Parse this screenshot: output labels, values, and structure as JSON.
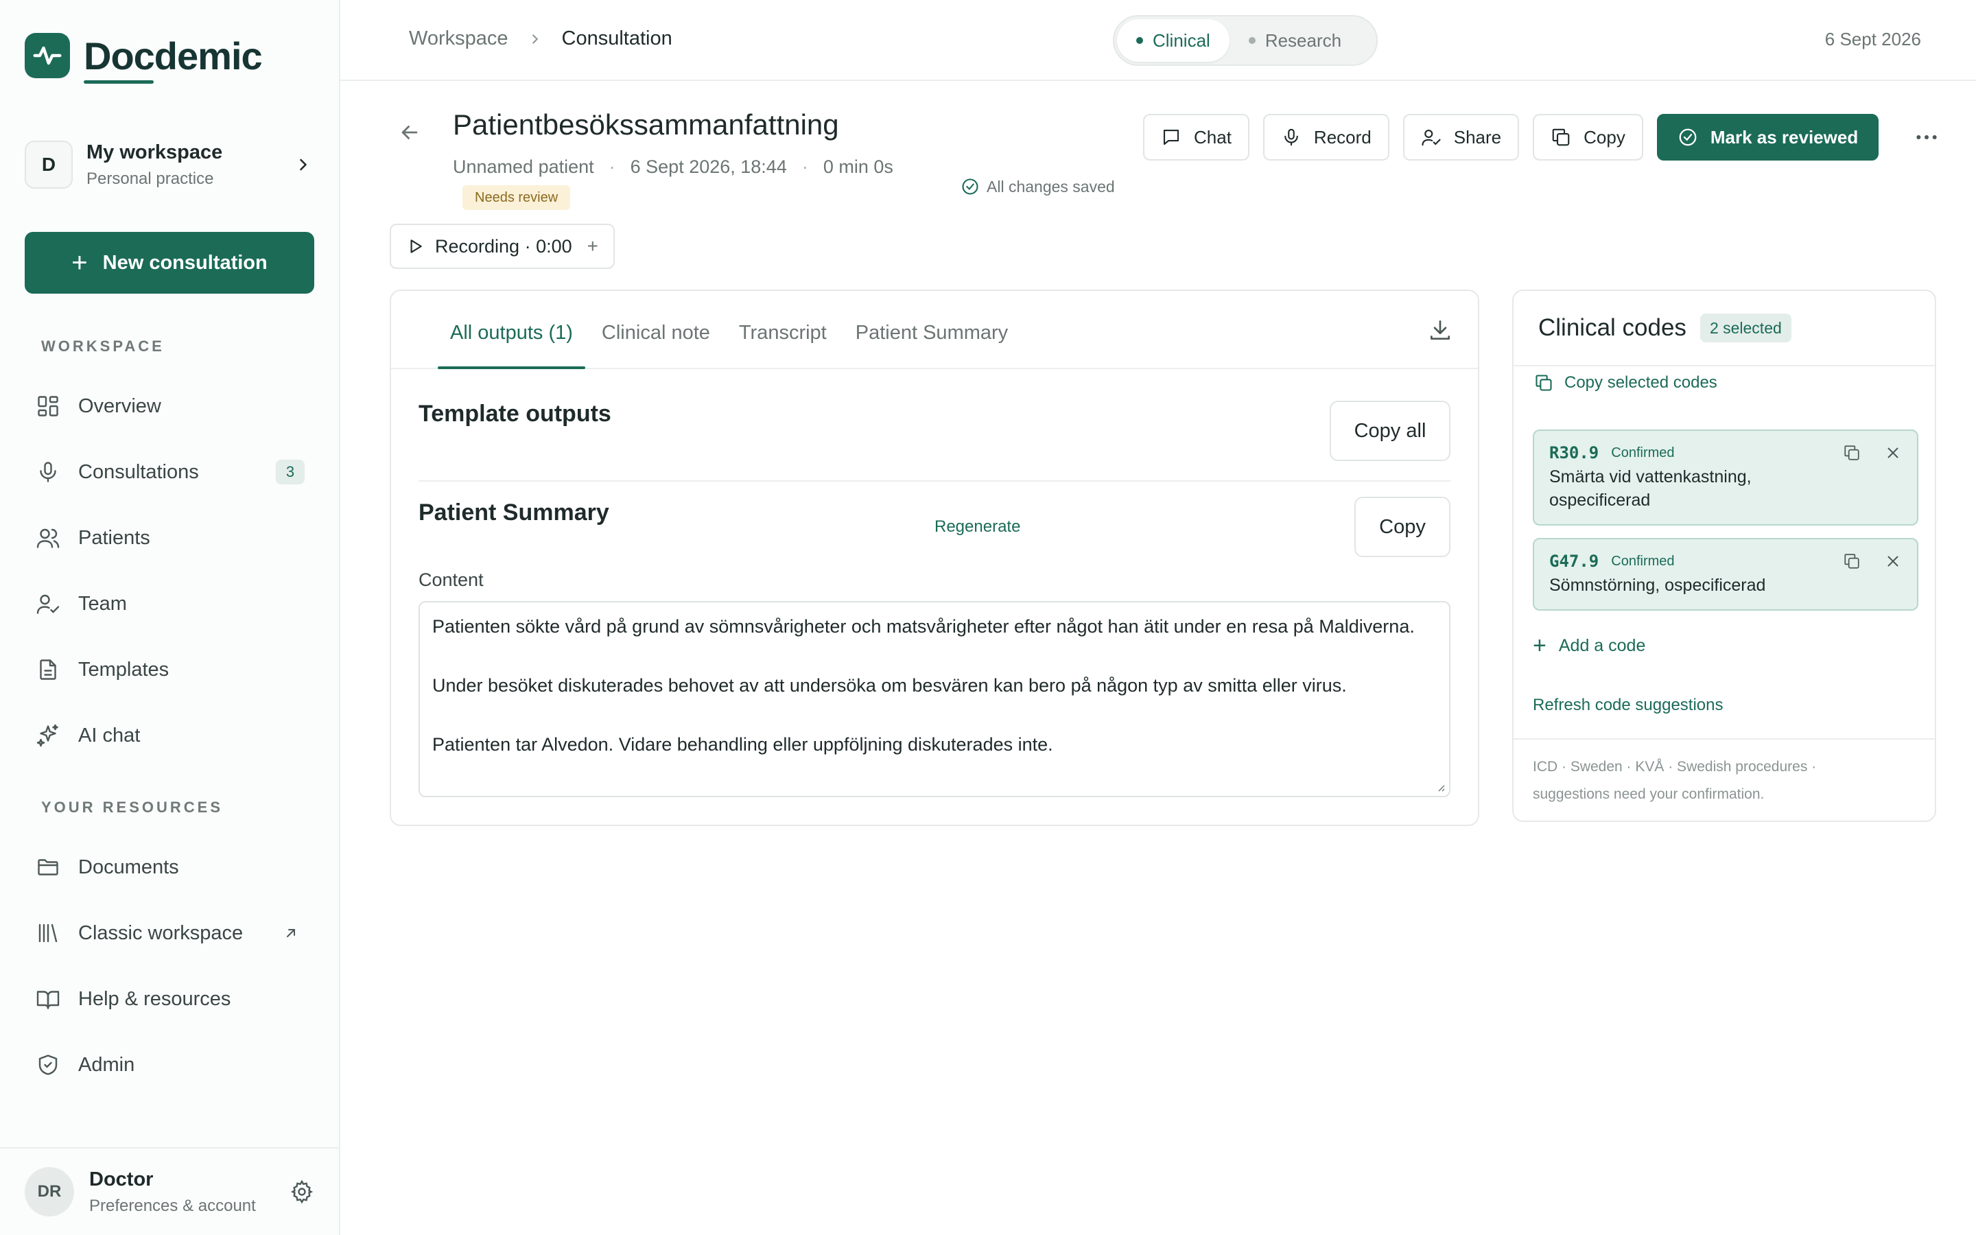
{
  "app": {
    "brand": "Docdemic",
    "workspace_title": "My workspace",
    "workspace_sub": "Personal practice",
    "workspace_initial": "D",
    "new_consultation": "New consultation"
  },
  "sidebar": {
    "workspace_label": "WORKSPACE",
    "resources_label": "YOUR RESOURCES",
    "items": [
      {
        "label": "Overview",
        "icon": "grid-icon"
      },
      {
        "label": "Consultations",
        "icon": "microphone-icon",
        "badge": "3"
      },
      {
        "label": "Patients",
        "icon": "users-icon"
      },
      {
        "label": "Team",
        "icon": "user-check-icon"
      },
      {
        "label": "Templates",
        "icon": "document-icon"
      },
      {
        "label": "AI chat",
        "icon": "sparkles-icon"
      }
    ],
    "resources": [
      {
        "label": "Documents",
        "icon": "folder-icon"
      },
      {
        "label": "Classic workspace",
        "icon": "library-icon"
      },
      {
        "label": "Help & resources",
        "icon": "book-icon"
      },
      {
        "label": "Admin",
        "icon": "shield-icon"
      }
    ],
    "user": {
      "initials": "DR",
      "name": "Doctor",
      "sub": "Preferences & account"
    }
  },
  "topbar": {
    "breadcrumb": [
      "Workspace",
      "Consultation"
    ],
    "modes": [
      "Clinical",
      "Research"
    ],
    "active_mode": "Clinical",
    "date": "6 Sept 2026"
  },
  "consultation": {
    "title": "Patientbesökssammanfattning",
    "patient": "Unnamed patient",
    "datetime": "6 Sept 2026, 18:44",
    "duration": "0 min 0s",
    "status": "Needs review",
    "saved": "All changes saved",
    "recording": "Recording · 0:00",
    "recording_add": "+"
  },
  "actions": {
    "chat": "Chat",
    "record": "Record",
    "share": "Share",
    "copy": "Copy",
    "mark_reviewed": "Mark as reviewed"
  },
  "outputs": {
    "tabs": [
      "All outputs (1)",
      "Clinical note",
      "Transcript",
      "Patient Summary"
    ],
    "active_tab": 0,
    "template_heading": "Template outputs",
    "copy_all": "Copy all",
    "summary_heading": "Patient Summary",
    "regenerate": "Regenerate",
    "copy": "Copy",
    "content_label": "Content",
    "content_paragraphs": [
      "Patienten sökte vård på grund av sömnsvårigheter och matsvårigheter efter något han ätit under en resa på Maldiverna.",
      "Under besöket diskuterades behovet av att undersöka om besvären kan bero på någon typ av smitta eller virus.",
      "Patienten tar Alvedon. Vidare behandling eller uppföljning diskuterades inte."
    ]
  },
  "codes": {
    "title": "Clinical codes",
    "selected_badge": "2 selected",
    "copy_selected": "Copy selected codes",
    "items": [
      {
        "code": "R30.9",
        "status": "Confirmed",
        "description": "Smärta vid vattenkastning, ospecificerad"
      },
      {
        "code": "G47.9",
        "status": "Confirmed",
        "description": "Sömnstörning, ospecificerad"
      }
    ],
    "add_code": "Add a code",
    "refresh": "Refresh code suggestions",
    "footnote": "ICD · Sweden · KVÅ · Swedish procedures · suggestions need your confirmation."
  },
  "colors": {
    "brand": "#1b6b57",
    "badge_bg": "#e3ede9",
    "code_bg": "#e4f1ec",
    "warning_bg": "#fbf1d9"
  }
}
